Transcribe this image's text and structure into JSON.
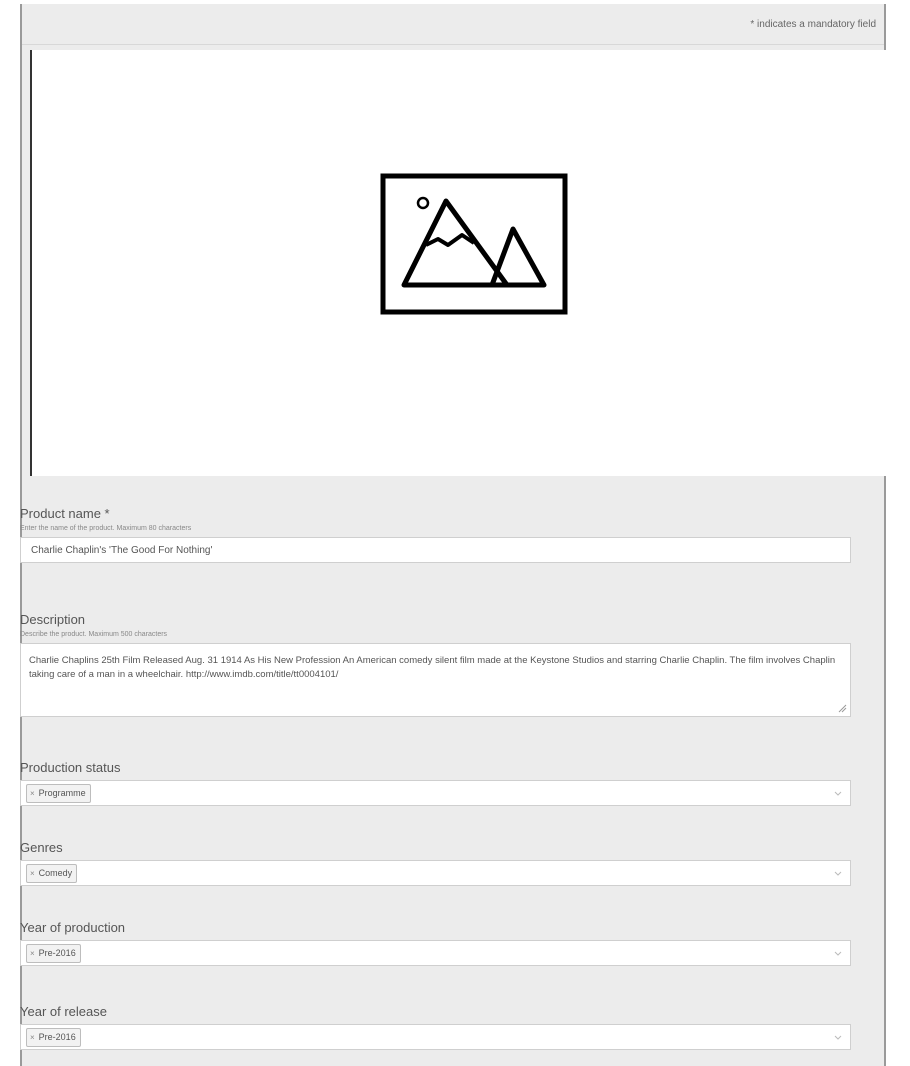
{
  "mandatory_note": "* indicates a mandatory field",
  "image_placeholder": {
    "icon": "image-placeholder-icon"
  },
  "product_name": {
    "label": "Product name *",
    "hint": "Enter the name of the product. Maximum 80 characters",
    "value": "Charlie Chaplin's 'The Good For Nothing'"
  },
  "description": {
    "label": "Description",
    "hint": "Describe the product. Maximum 500 characters",
    "value": "Charlie Chaplins 25th Film Released Aug. 31 1914 As His New Profession An American comedy silent film made at the Keystone Studios and starring Charlie Chaplin. The film involves Chaplin taking care of a man in a wheelchair. http://www.imdb.com/title/tt0004101/"
  },
  "production_status": {
    "label": "Production status",
    "selected": "Programme"
  },
  "genres": {
    "label": "Genres",
    "selected": "Comedy"
  },
  "year_of_production": {
    "label": "Year of production",
    "selected": "Pre-2016"
  },
  "year_of_release": {
    "label": "Year of release",
    "selected": "Pre-2016"
  },
  "chip_remove_glyph": "×"
}
